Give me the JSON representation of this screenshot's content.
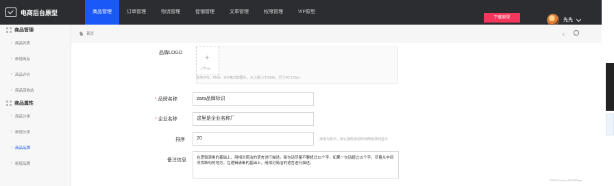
{
  "topbar": {
    "brand": "电商后台原型",
    "nav": [
      "商品管理",
      "订单管理",
      "物流管理",
      "促销管理",
      "文章管理",
      "权限管理",
      "VIP原型"
    ],
    "download": "下载原型",
    "user": "先先"
  },
  "sidebar": {
    "groups": [
      {
        "title": "商品管理",
        "items": [
          "商品列表",
          "新增商品",
          "商品评价",
          "商品回收站"
        ]
      },
      {
        "title": "商品属性",
        "items": [
          "商品分类",
          "新增分类",
          "商品品牌",
          "新增品牌"
        ]
      }
    ]
  },
  "breadcrumb": {
    "home": "首页"
  },
  "form": {
    "logo_label": "品牌LOGO",
    "upload_text": "上传logo",
    "upload_hint": "支持JPG、PNG、GIF格式的图片，大小需小于200K，尺寸90*170px",
    "brand_label": "品牌名称",
    "brand_value": "zara品牌标识",
    "company_label": "企业名称",
    "company_value": "这里是企业名称厂",
    "sort_label": "排序",
    "sort_value": "20",
    "sort_hint": "排序为数字，默认按照添加时间倒序排列显示",
    "remark_label": "备注信息",
    "remark_text": "在逻辑清晰的基础上，用相对简洁的语言进行描述。每句话尽量不要超过15个字，如果一句话超过15个字，尽量从中间寻找断句的地方。在逻辑清晰的基础上，用相对简洁的语言进行描述。"
  },
  "watermark": "©2024 Vonne_AFMMTaya",
  "colors": {
    "primary": "#1a58f7",
    "download": "#f5365c",
    "topbar": "#2b2d31"
  }
}
